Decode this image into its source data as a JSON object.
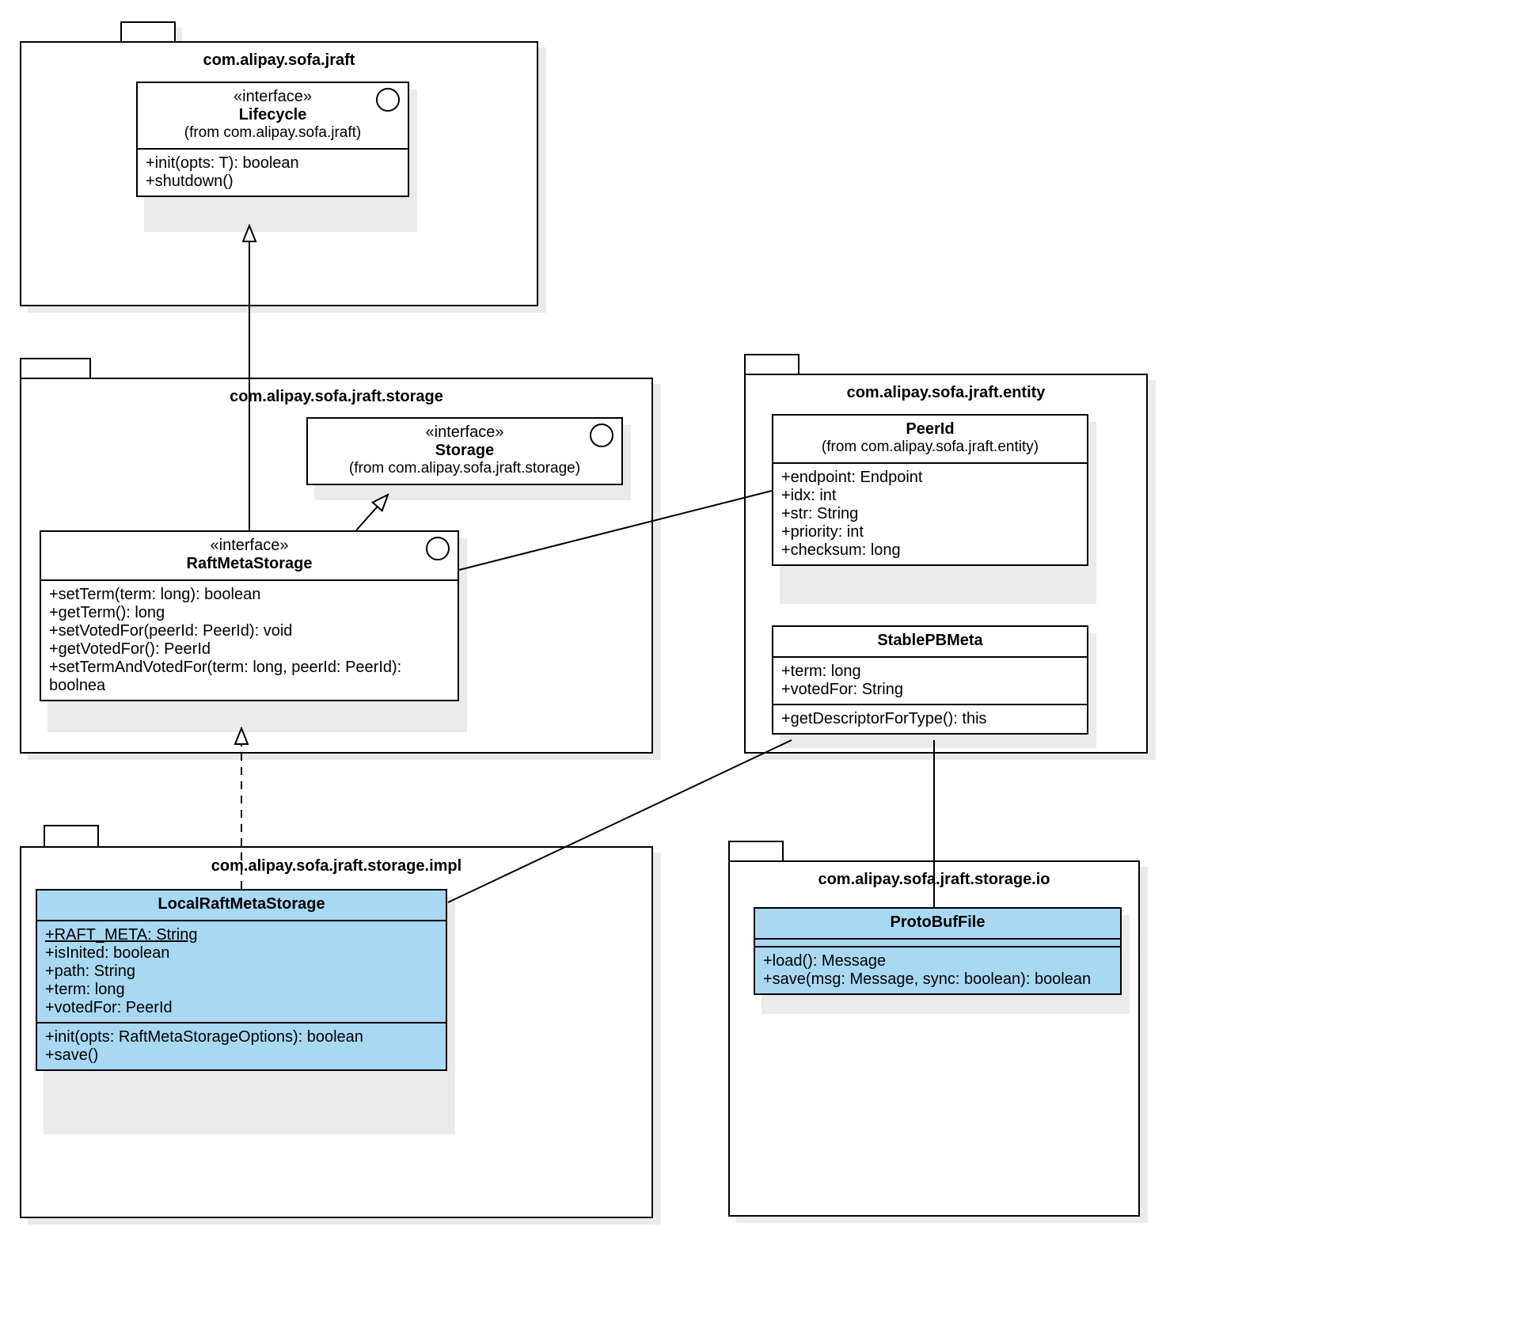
{
  "packages": {
    "jraft": {
      "title": "com.alipay.sofa.jraft"
    },
    "storage": {
      "title": "com.alipay.sofa.jraft.storage"
    },
    "entity": {
      "title": "com.alipay.sofa.jraft.entity"
    },
    "impl": {
      "title": "com.alipay.sofa.jraft.storage.impl"
    },
    "io": {
      "title": "com.alipay.sofa.jraft.storage.io"
    }
  },
  "classes": {
    "lifecycle": {
      "stereo": "«interface»",
      "name": "Lifecycle",
      "from": "(from com.alipay.sofa.jraft)",
      "ops": "+init(opts: T): boolean\n+shutdown()"
    },
    "storageIface": {
      "stereo": "«interface»",
      "name": "Storage",
      "from": "(from com.alipay.sofa.jraft.storage)"
    },
    "raftMeta": {
      "stereo": "«interface»",
      "name": "RaftMetaStorage",
      "ops": "+setTerm(term: long): boolean\n+getTerm(): long\n+setVotedFor(peerId: PeerId): void\n+getVotedFor(): PeerId\n+setTermAndVotedFor(term: long, peerId: PeerId): boolnea"
    },
    "peerId": {
      "name": "PeerId",
      "from": "(from com.alipay.sofa.jraft.entity)",
      "attrs": "+endpoint: Endpoint\n+idx: int\n+str: String\n+priority: int\n+checksum: long"
    },
    "stablePB": {
      "name": "StablePBMeta",
      "attrs": "+term: long\n+votedFor: String",
      "ops": "+getDescriptorForType(): this"
    },
    "localRaft": {
      "name": "LocalRaftMetaStorage",
      "attr_static": "+RAFT_META: String",
      "attrs": "+isInited: boolean\n+path: String\n+term: long\n+votedFor: PeerId",
      "ops": "+init(opts: RaftMetaStorageOptions): boolean\n+save()"
    },
    "protoBuf": {
      "name": "ProtoBufFile",
      "ops": "+load(): Message\n+save(msg: Message, sync: boolean): boolean"
    }
  },
  "chart_data": {
    "type": "uml-class-diagram",
    "packages": [
      {
        "name": "com.alipay.sofa.jraft",
        "classifiers": [
          {
            "name": "Lifecycle",
            "kind": "interface",
            "operations": [
              "+init(opts: T): boolean",
              "+shutdown()"
            ]
          }
        ]
      },
      {
        "name": "com.alipay.sofa.jraft.storage",
        "classifiers": [
          {
            "name": "Storage",
            "kind": "interface",
            "operations": []
          },
          {
            "name": "RaftMetaStorage",
            "kind": "interface",
            "operations": [
              "+setTerm(term: long): boolean",
              "+getTerm(): long",
              "+setVotedFor(peerId: PeerId): void",
              "+getVotedFor(): PeerId",
              "+setTermAndVotedFor(term: long, peerId: PeerId): boolnea"
            ]
          }
        ]
      },
      {
        "name": "com.alipay.sofa.jraft.entity",
        "classifiers": [
          {
            "name": "PeerId",
            "kind": "class",
            "attributes": [
              "+endpoint: Endpoint",
              "+idx: int",
              "+str: String",
              "+priority: int",
              "+checksum: long"
            ]
          },
          {
            "name": "StablePBMeta",
            "kind": "class",
            "attributes": [
              "+term: long",
              "+votedFor: String"
            ],
            "operations": [
              "+getDescriptorForType(): this"
            ]
          }
        ]
      },
      {
        "name": "com.alipay.sofa.jraft.storage.impl",
        "classifiers": [
          {
            "name": "LocalRaftMetaStorage",
            "kind": "class",
            "highlighted": true,
            "attributes": [
              "+RAFT_META: String (static)",
              "+isInited: boolean",
              "+path: String",
              "+term: long",
              "+votedFor: PeerId"
            ],
            "operations": [
              "+init(opts: RaftMetaStorageOptions): boolean",
              "+save()"
            ]
          }
        ]
      },
      {
        "name": "com.alipay.sofa.jraft.storage.io",
        "classifiers": [
          {
            "name": "ProtoBufFile",
            "kind": "class",
            "highlighted": true,
            "operations": [
              "+load(): Message",
              "+save(msg: Message, sync: boolean): boolean"
            ]
          }
        ]
      }
    ],
    "relationships": [
      {
        "type": "generalization",
        "from": "RaftMetaStorage",
        "to": "Lifecycle"
      },
      {
        "type": "generalization",
        "from": "RaftMetaStorage",
        "to": "Storage"
      },
      {
        "type": "realization",
        "from": "LocalRaftMetaStorage",
        "to": "RaftMetaStorage"
      },
      {
        "type": "association",
        "from": "RaftMetaStorage",
        "to": "PeerId"
      },
      {
        "type": "association",
        "from": "LocalRaftMetaStorage",
        "to": "StablePBMeta"
      },
      {
        "type": "association",
        "from": "StablePBMeta",
        "to": "ProtoBufFile"
      }
    ]
  }
}
